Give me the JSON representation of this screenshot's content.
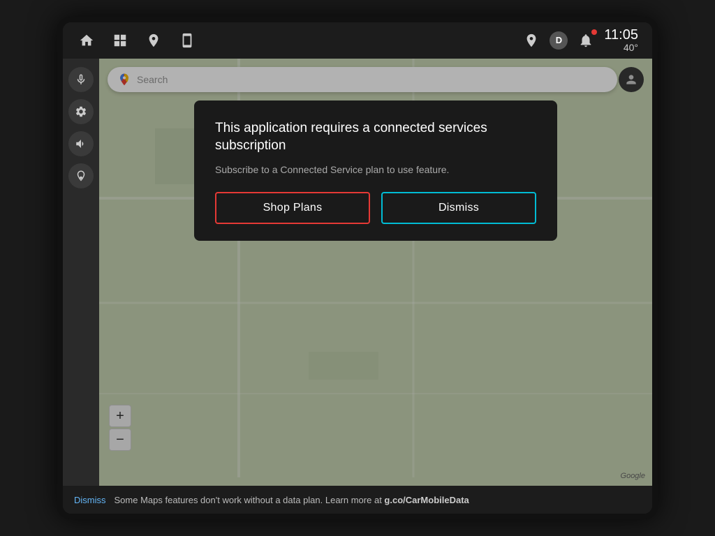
{
  "statusBar": {
    "time": "11:05",
    "temp": "40°",
    "dBadge": "D"
  },
  "searchBar": {
    "placeholder": "Search"
  },
  "modal": {
    "title": "This application requires a connected services subscription",
    "subtitle": "Subscribe to a Connected Service plan to use feature.",
    "shopPlansLabel": "Shop Plans",
    "dismissLabel": "Dismiss"
  },
  "zoomControls": {
    "plus": "+",
    "minus": "−"
  },
  "googleWatermark": "Google",
  "bottomBanner": {
    "dismissLink": "Dismiss",
    "text": "Some Maps features don't work without a data plan. Learn more at ",
    "link": "g.co/CarMobileData"
  },
  "sidebar": {
    "micLabel": "microphone",
    "settingsLabel": "settings",
    "volumeLabel": "volume",
    "routeLabel": "route"
  }
}
